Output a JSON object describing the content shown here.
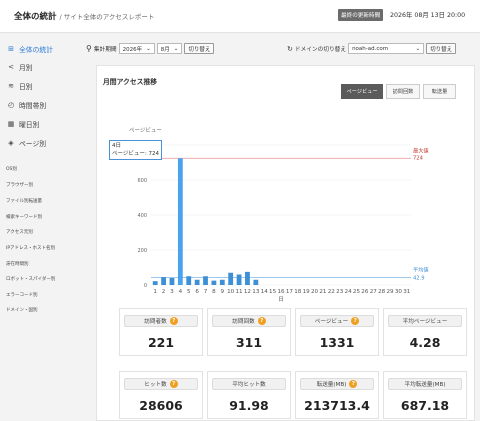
{
  "header": {
    "title": "全体の統計",
    "subtitle": "/ サイト全体のアクセスレポート",
    "updated_label": "最終の更新時間",
    "updated_value": "2026年 08月 13日 20:00"
  },
  "sidebar": {
    "items": [
      {
        "label": "全体の統計",
        "icon": "grid-icon"
      },
      {
        "label": "月別",
        "icon": "share-icon"
      },
      {
        "label": "日別",
        "icon": "activity-icon"
      },
      {
        "label": "時間帯別",
        "icon": "clock-icon"
      },
      {
        "label": "曜日別",
        "icon": "calendar-icon"
      },
      {
        "label": "ページ別",
        "icon": "layers-icon"
      }
    ],
    "subitems": [
      "OS別",
      "ブラウザー別",
      "ファイル別転送量",
      "検索キーワード別",
      "アクセス元別",
      "IPアドレス・ホスト名別",
      "滞在時間別",
      "ロボット・スパイダー別",
      "エラーコード別",
      "ドメイン・国別"
    ]
  },
  "filters": {
    "period_label": "集計期間",
    "year": "2026年",
    "month": "8月",
    "switch_label": "切り替え",
    "domain_label": "ドメインの切り替え",
    "domain": "noah-ad.com",
    "domain_switch_label": "切り替え"
  },
  "chart_section": {
    "title": "月間アクセス推移",
    "tabs": [
      "ページビュー",
      "訪問回数",
      "転送量"
    ],
    "tooltip_day": "4日",
    "tooltip_text": "ページビュー: 724"
  },
  "chart_data": {
    "type": "bar",
    "ylabel": "ページビュー",
    "xlabel": "日",
    "ylim": [
      0,
      800
    ],
    "yticks": [
      0,
      200,
      400,
      600,
      800
    ],
    "categories": [
      "1",
      "2",
      "3",
      "4",
      "5",
      "6",
      "7",
      "8",
      "9",
      "10",
      "11",
      "12",
      "13",
      "14",
      "15",
      "16",
      "17",
      "18",
      "19",
      "20",
      "21",
      "22",
      "23",
      "24",
      "25",
      "26",
      "27",
      "28",
      "29",
      "30",
      "31"
    ],
    "values": [
      22,
      45,
      40,
      724,
      50,
      30,
      50,
      25,
      30,
      70,
      60,
      75,
      30,
      0,
      0,
      0,
      0,
      0,
      0,
      0,
      0,
      0,
      0,
      0,
      0,
      0,
      0,
      0,
      0,
      0,
      0
    ],
    "max_label": "最大値",
    "max_value": "724",
    "avg_label": "平均値",
    "avg_value": "42.9",
    "colors": {
      "bar": "#3d8fd6",
      "highlight": "#4aa3ee",
      "max_line": "#e8a3a3",
      "avg_line": "#7fb6e8",
      "max_text": "#c0392b",
      "avg_text": "#3d8fd6"
    }
  },
  "stats": [
    {
      "label": "訪問者数",
      "value": "221",
      "help": true
    },
    {
      "label": "訪問回数",
      "value": "311",
      "help": true
    },
    {
      "label": "ページビュー",
      "value": "1331",
      "help": true
    },
    {
      "label": "平均ページビュー",
      "value": "4.28",
      "help": false
    },
    {
      "label": "ヒット数",
      "value": "28606",
      "help": true
    },
    {
      "label": "平均ヒット数",
      "value": "91.98",
      "help": false
    },
    {
      "label": "転送量(MB)",
      "value": "213713.4",
      "help": true
    },
    {
      "label": "平均転送量(MB)",
      "value": "687.18",
      "help": false
    }
  ]
}
